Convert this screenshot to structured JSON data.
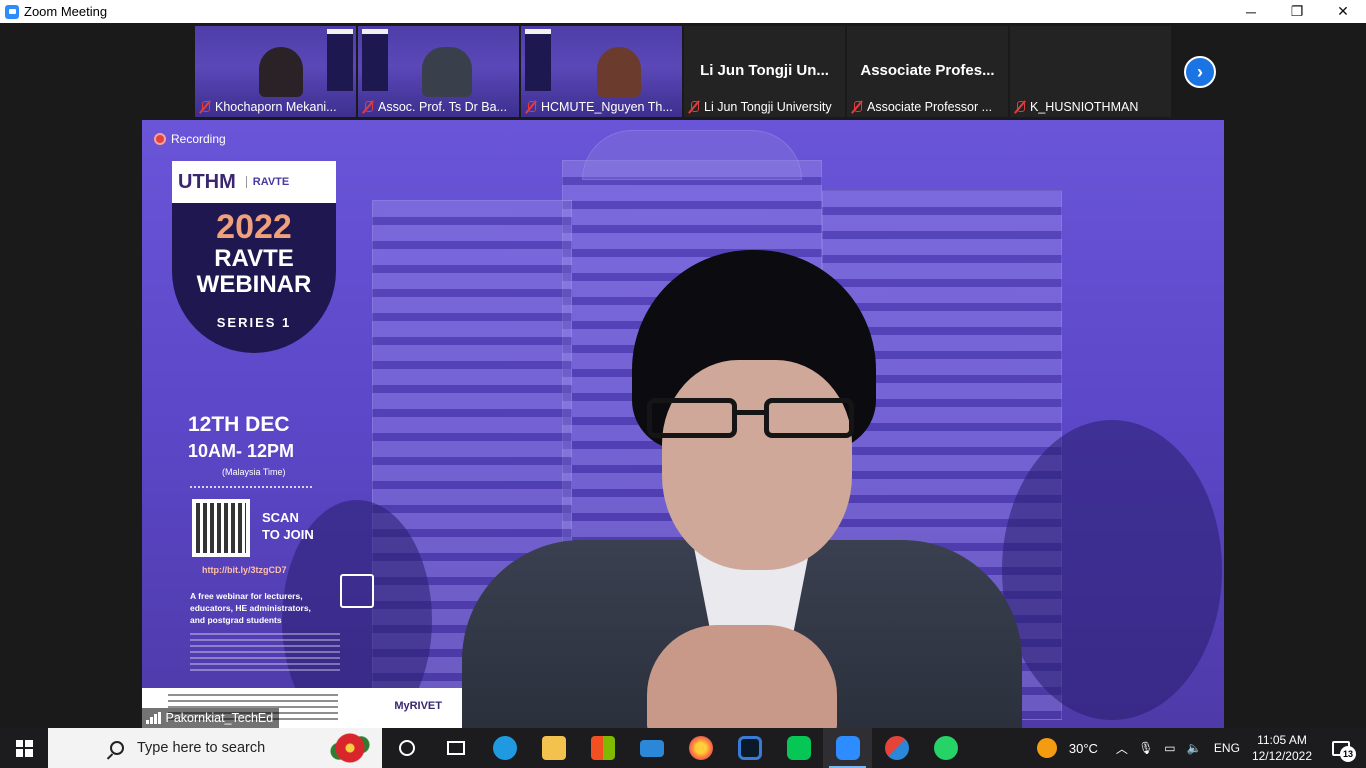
{
  "window": {
    "title": "Zoom Meeting",
    "controls": {
      "minimize": "─",
      "restore": "❐",
      "close": "✕"
    }
  },
  "participants_strip": [
    {
      "name": "Khochaporn Mekani...",
      "has_video": true,
      "muted": true
    },
    {
      "name": "Assoc. Prof. Ts Dr Ba...",
      "has_video": true,
      "muted": true
    },
    {
      "name": "HCMUTE_Nguyen Th...",
      "has_video": true,
      "muted": true
    },
    {
      "name": "Li Jun Tongji University",
      "display_title": "Li Jun Tongji Un...",
      "has_video": false,
      "muted": true
    },
    {
      "name": "Associate Professor ...",
      "display_title": "Associate Profes...",
      "has_video": false,
      "muted": true
    },
    {
      "name": "K_HUSNIOTHMAN",
      "display_title": "",
      "has_video": false,
      "muted": true
    }
  ],
  "next_page_icon": "chevron-right-icon",
  "main_video": {
    "recording_label": "Recording",
    "speaker_name": "Pakornkiat_TechEd",
    "poster": {
      "logo_main": "UTHM",
      "logo_secondary": "RAVTE",
      "year": "2022",
      "title_line1": "RAVTE",
      "title_line2": "WEBINAR",
      "series": "SERIES 1",
      "date": "12TH DEC",
      "time": "10AM- 12PM",
      "timezone": "(Malaysia Time)",
      "scan_line1": "SCAN",
      "scan_line2": "TO JOIN",
      "link": "http://bit.ly/3tzgCD7",
      "description": "A free webinar for lecturers, educators, HE administrators, and postgrad students",
      "footer_logo": "MyRIVET"
    }
  },
  "taskbar": {
    "search_placeholder": "Type here to search",
    "apps": [
      {
        "name": "cortana-icon"
      },
      {
        "name": "task-view-icon"
      },
      {
        "name": "edge-icon",
        "color": "#1f9ae0"
      },
      {
        "name": "file-explorer-icon",
        "color": "#f2c14e"
      },
      {
        "name": "microsoft-store-icon",
        "color": "#2b88d8"
      },
      {
        "name": "mail-icon",
        "color": "#2b88d8"
      },
      {
        "name": "firefox-icon",
        "color": "#ff7139"
      },
      {
        "name": "webex-icon",
        "color": "#3a7bd5"
      },
      {
        "name": "line-icon",
        "color": "#06c755"
      },
      {
        "name": "zoom-icon",
        "color": "#2d8cff",
        "active": true
      },
      {
        "name": "snipping-tool-icon",
        "color": "#e5443b"
      },
      {
        "name": "whatsapp-icon",
        "color": "#25d366"
      }
    ],
    "weather_temp": "30°C",
    "language": "ENG",
    "time": "11:05 AM",
    "date": "12/12/2022",
    "notification_count": "13"
  }
}
